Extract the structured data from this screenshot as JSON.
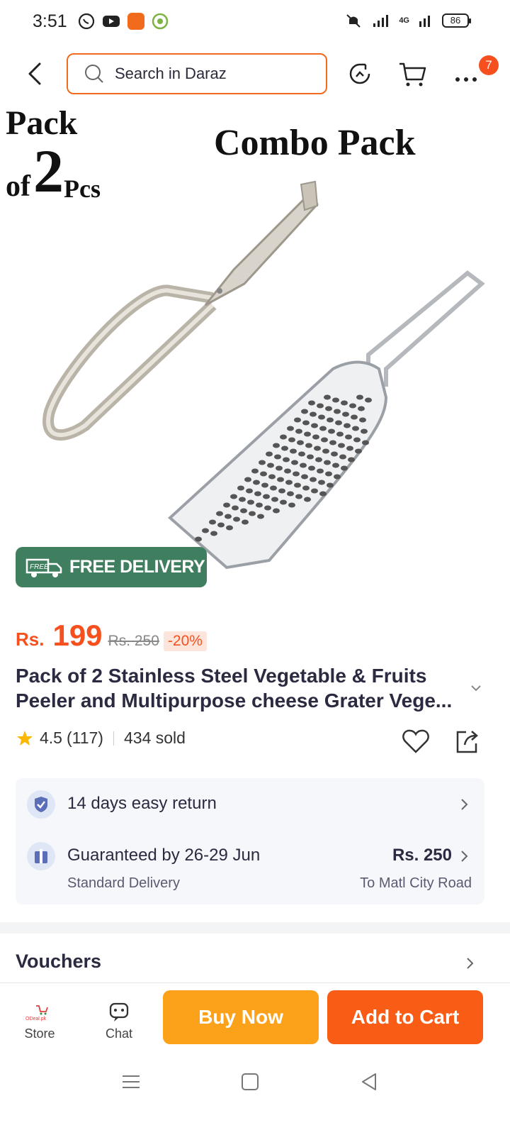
{
  "status_bar": {
    "time": "3:51",
    "battery": "86",
    "network": "4G"
  },
  "search": {
    "placeholder": "Search in Daraz"
  },
  "cart_badge": "7",
  "hero": {
    "pack_line1": "Pack",
    "pack_line2": "of",
    "pack_number": "2",
    "pack_unit": "Pcs",
    "combo": "Combo Pack",
    "free_delivery": "FREE DELIVERY",
    "free_truck_text": "FREE"
  },
  "price": {
    "currency": "Rs.",
    "amount": "199",
    "original": "Rs. 250",
    "discount": "-20%"
  },
  "product": {
    "title_line1": "Pack of 2 Stainless Steel Vegetable & Fruits",
    "title_line2": "Peeler and Multipurpose cheese Grater Vege..."
  },
  "rating": {
    "score": "4.5",
    "count": "(117)",
    "sold": "434 sold"
  },
  "services": {
    "return_label": "14 days easy return",
    "delivery_label": "Guaranteed by 26-29 Jun",
    "delivery_type": "Standard Delivery",
    "delivery_price": "Rs. 250",
    "delivery_to": "To Matl City Road"
  },
  "vouchers": {
    "label": "Vouchers"
  },
  "bottom_bar": {
    "store_label": "Store",
    "store_logo_text": "ODeal.pk",
    "chat_label": "Chat",
    "buy_now": "Buy Now",
    "add_to_cart": "Add to Cart"
  },
  "colors": {
    "accent": "#f5501e",
    "buy_now": "#fca21a",
    "add_to_cart": "#f95c14",
    "free_delivery_bg": "#3f7f5f"
  }
}
